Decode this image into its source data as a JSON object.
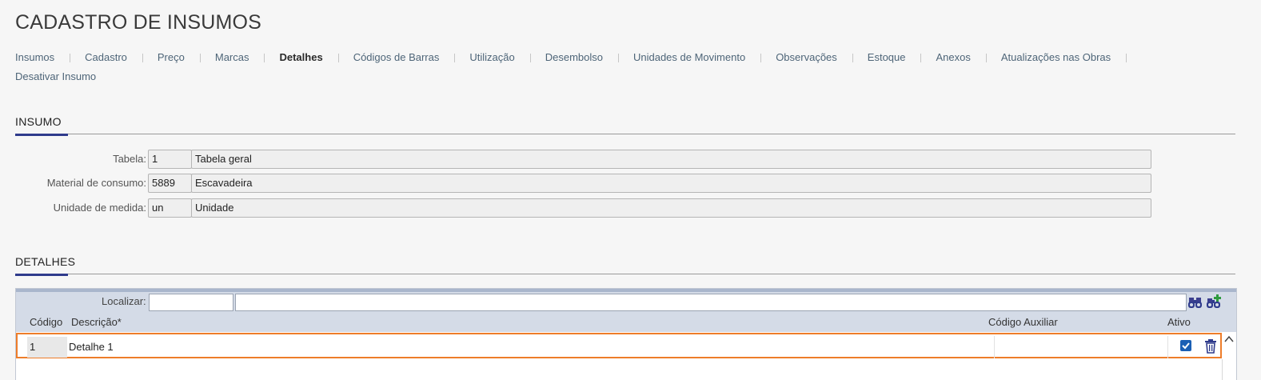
{
  "page": {
    "title": "CADASTRO DE INSUMOS"
  },
  "tabs": [
    {
      "label": "Insumos",
      "active": false
    },
    {
      "label": "Cadastro",
      "active": false
    },
    {
      "label": "Preço",
      "active": false
    },
    {
      "label": "Marcas",
      "active": false
    },
    {
      "label": "Detalhes",
      "active": true
    },
    {
      "label": "Códigos de Barras",
      "active": false
    },
    {
      "label": "Utilização",
      "active": false
    },
    {
      "label": "Desembolso",
      "active": false
    },
    {
      "label": "Unidades de Movimento",
      "active": false
    },
    {
      "label": "Observações",
      "active": false
    },
    {
      "label": "Estoque",
      "active": false
    },
    {
      "label": "Anexos",
      "active": false
    },
    {
      "label": "Atualizações nas Obras",
      "active": false
    },
    {
      "label": "Desativar Insumo",
      "active": false
    }
  ],
  "insumo": {
    "section_title": "INSUMO",
    "fields": [
      {
        "label": "Tabela",
        "code": "1",
        "desc": "Tabela geral"
      },
      {
        "label": "Material de consumo",
        "code": "5889",
        "desc": "Escavadeira"
      },
      {
        "label": "Unidade de medida",
        "code": "un",
        "desc": "Unidade"
      }
    ]
  },
  "detalhes": {
    "section_title": "DETALHES",
    "find_label": "Localizar:",
    "columns": {
      "codigo": "Código",
      "descricao": "Descrição*",
      "codigo_aux": "Código Auxiliar",
      "ativo": "Ativo"
    },
    "rows": [
      {
        "codigo": "1",
        "descricao": "Detalhe 1",
        "codigo_aux": "",
        "ativo": true
      }
    ]
  },
  "colors": {
    "accent": "#2f3b8c",
    "selection": "#ee7d2a",
    "checkbox": "#1a5fb4",
    "grid_header": "#d4dbe7"
  }
}
